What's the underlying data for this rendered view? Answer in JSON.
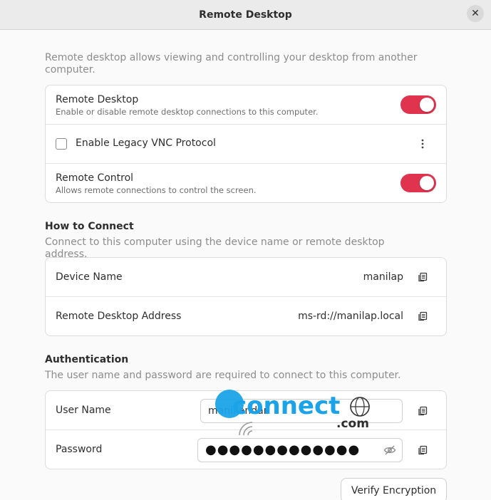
{
  "window": {
    "title": "Remote Desktop",
    "close_glyph": "✕"
  },
  "intro": "Remote desktop allows viewing and controlling your desktop from another computer.",
  "sharing": {
    "remote_desktop": {
      "title": "Remote Desktop",
      "subtitle": "Enable or disable remote desktop connections to this computer.",
      "enabled": true
    },
    "legacy_vnc": {
      "label": "Enable Legacy VNC Protocol",
      "checked": false,
      "menu_icon": "kebab-menu-icon"
    },
    "remote_control": {
      "title": "Remote Control",
      "subtitle": "Allows remote connections to control the screen.",
      "enabled": true
    }
  },
  "how_to_connect": {
    "heading": "How to Connect",
    "description": "Connect to this computer using the device name or remote desktop address.",
    "device_name": {
      "label": "Device Name",
      "value": "manilap"
    },
    "address": {
      "label": "Remote Desktop Address",
      "value": "ms-rd://manilap.local"
    }
  },
  "authentication": {
    "heading": "Authentication",
    "description": "The user name and password are required to connect to this computer.",
    "username": {
      "label": "User Name",
      "value": "manikandan"
    },
    "password": {
      "label": "Password",
      "value": "●●●●●●●●●●●●●"
    }
  },
  "verify_button": "Verify Encryption",
  "watermark": {
    "text": "connect",
    "suffix": ".com"
  },
  "colors": {
    "accent": "#e0344e",
    "watermark": "#1aa3e8"
  }
}
